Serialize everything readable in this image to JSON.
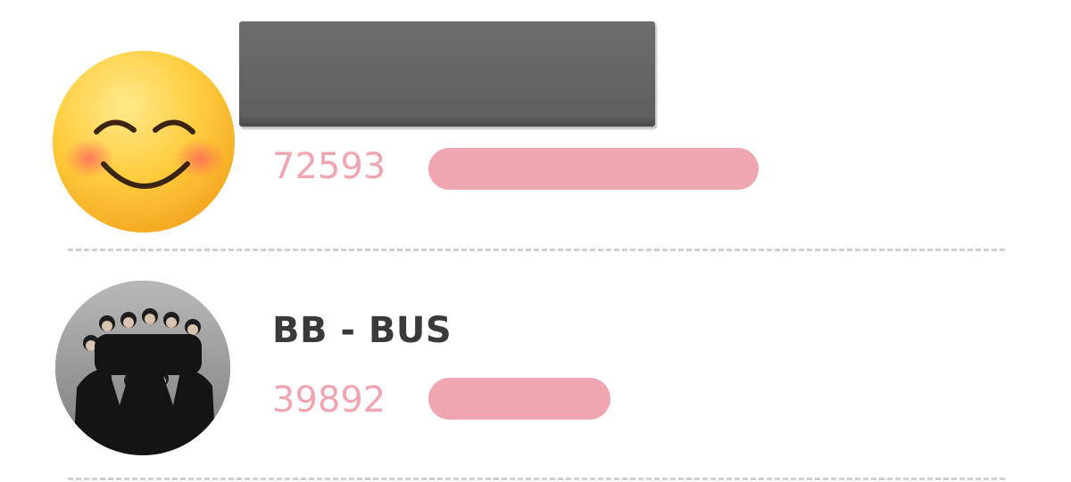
{
  "entries": [
    {
      "name": "",
      "name_redacted": true,
      "avatar": "smiling-face-with-blush-emoji",
      "count": "72593",
      "bar_fraction": 1.0
    },
    {
      "name": "BB - BUS",
      "avatar": "group-photo",
      "count": "39892",
      "bar_fraction": 0.55
    }
  ],
  "colors": {
    "bar": "#f0a6b1",
    "count_text": "#f0a6b1",
    "name_text": "#3a3a3a",
    "divider": "#cfcfcf",
    "redaction": "#666666"
  }
}
